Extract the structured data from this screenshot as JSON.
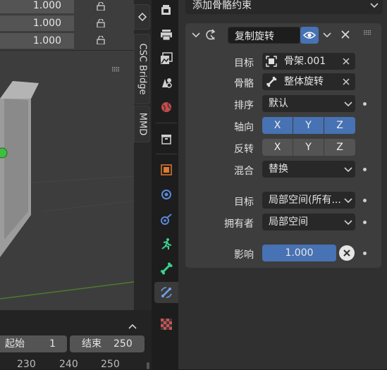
{
  "viewport": {
    "transform_values": [
      "1.000",
      "1.000",
      "1.000"
    ],
    "side_tabs": [
      "CSC Bridge",
      "MMD"
    ]
  },
  "timeline": {
    "start_label": "起始",
    "start_value": "1",
    "end_label": "结束",
    "end_value": "250",
    "frame_numbers": [
      "230",
      "240",
      "250"
    ]
  },
  "property_tabs": [
    {
      "name": "render",
      "icon": "camera-back-icon"
    },
    {
      "name": "output",
      "icon": "printer-icon"
    },
    {
      "name": "view-layer",
      "icon": "image-stack-icon"
    },
    {
      "name": "scene",
      "icon": "scene-cone-icon"
    },
    {
      "name": "world",
      "icon": "globe-icon"
    },
    {
      "name": "collection",
      "icon": "box-icon"
    },
    {
      "name": "object",
      "icon": "object-square-icon"
    },
    {
      "name": "modifiers",
      "icon": "wrench-circle-icon"
    },
    {
      "name": "particles",
      "icon": "particles-icon"
    },
    {
      "name": "physics",
      "icon": "running-figure-icon"
    },
    {
      "name": "bone",
      "icon": "bone-icon"
    },
    {
      "name": "bone-constraints",
      "icon": "bone-constraint-icon"
    },
    {
      "name": "texture",
      "icon": "checker-icon"
    }
  ],
  "properties": {
    "add_constraint_label": "添加骨骼约束",
    "constraint": {
      "name": "复制旋转",
      "target_label": "目标",
      "target_value": "骨架.001",
      "bone_label": "骨骼",
      "bone_value": "整体旋转",
      "order_label": "排序",
      "order_value": "默认",
      "axis_label": "轴向",
      "axis_options": [
        "X",
        "Y",
        "Z"
      ],
      "invert_label": "反转",
      "invert_options": [
        "X",
        "Y",
        "Z"
      ],
      "mix_label": "混合",
      "mix_value": "替换",
      "target_space_label": "目标",
      "target_space_value": "局部空间(所有...",
      "owner_space_label": "拥有者",
      "owner_space_value": "局部空间",
      "influence_label": "影响",
      "influence_value": "1.000"
    }
  },
  "colors": {
    "accent": "#4772b3",
    "active_tab_icon": "#70a0e8"
  }
}
